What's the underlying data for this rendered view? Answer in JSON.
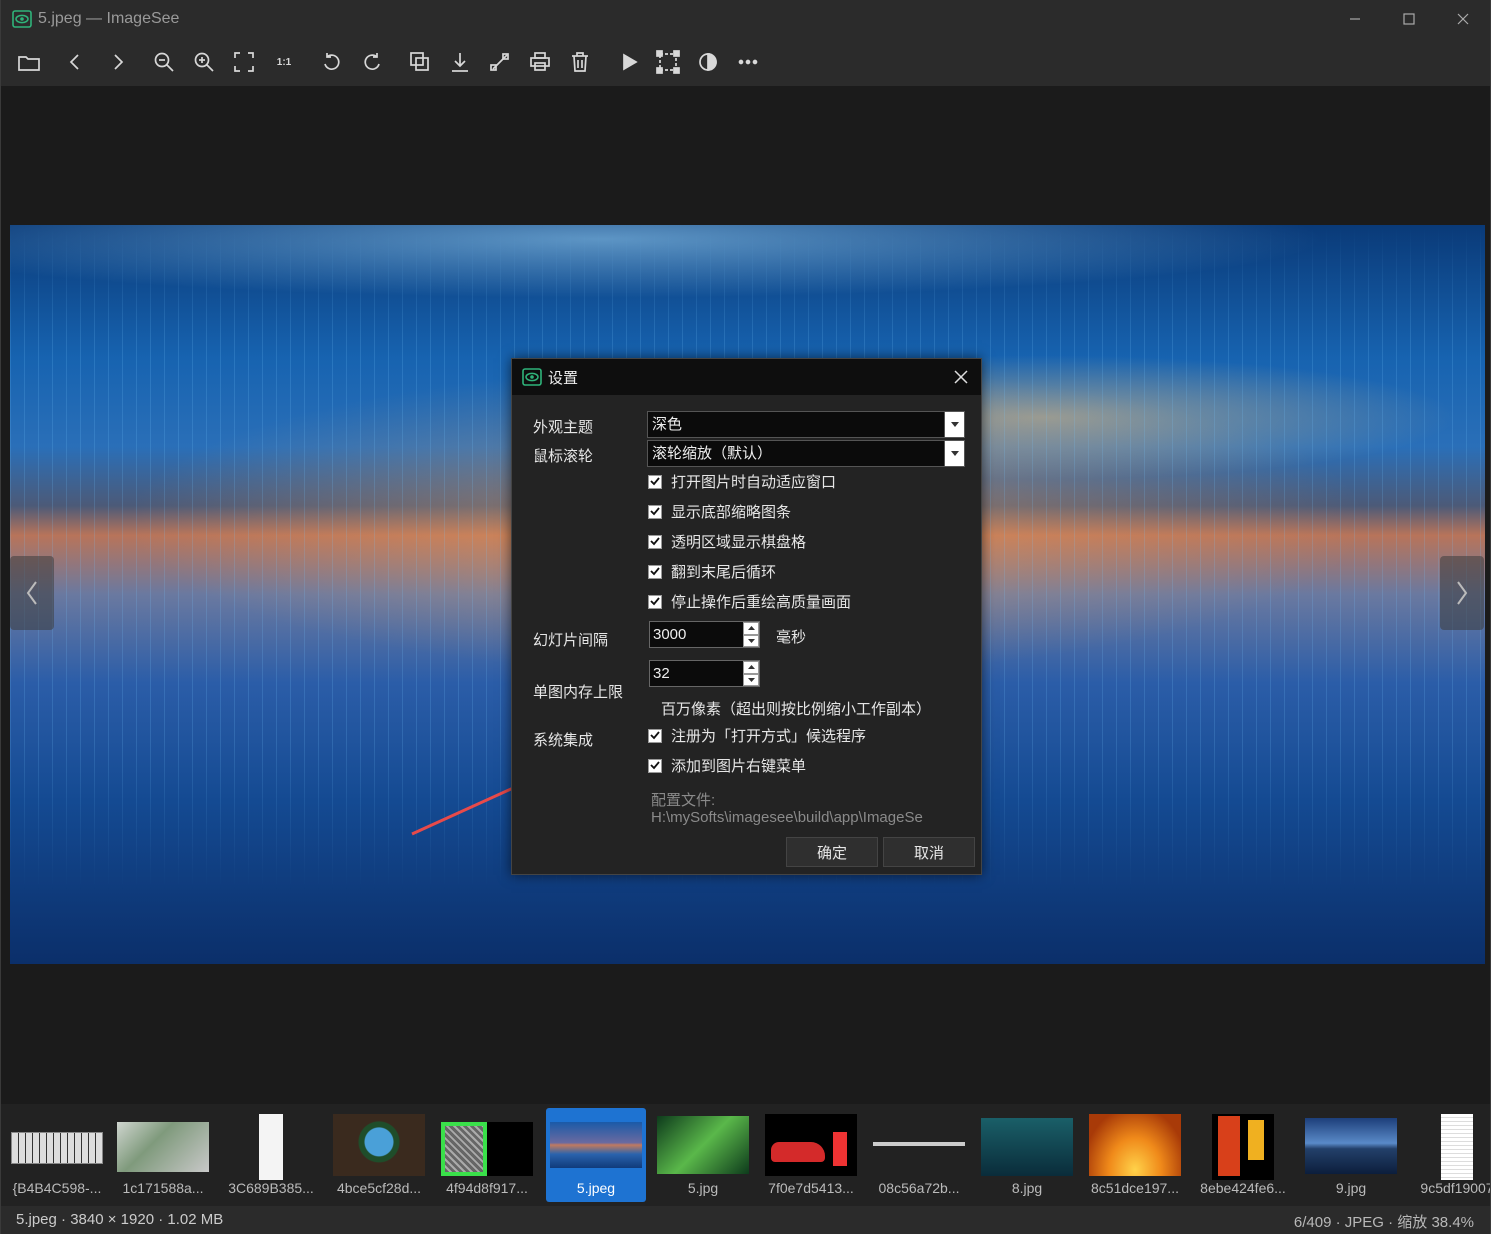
{
  "window": {
    "title": "5.jpeg",
    "separator": "—",
    "app_name": "ImageSee"
  },
  "toolbar": {
    "buttons": [
      "open-folder",
      "previous",
      "next",
      "zoom-out",
      "zoom-in",
      "fit-window",
      "actual-size",
      "rotate-left",
      "rotate-right",
      "copy",
      "save",
      "resize",
      "print",
      "delete",
      "slideshow",
      "crop",
      "adjust",
      "more"
    ],
    "actual_size_label": "1:1"
  },
  "dialog": {
    "title": "设置",
    "theme_label": "外观主题",
    "theme_value": "深色",
    "wheel_label": "鼠标滚轮",
    "wheel_value": "滚轮缩放（默认）",
    "checks": [
      "打开图片时自动适应窗口",
      "显示底部缩略图条",
      "透明区域显示棋盘格",
      "翻到末尾后循环",
      "停止操作后重绘高质量画面"
    ],
    "slideshow_label": "幻灯片间隔",
    "slideshow_value": "3000",
    "slideshow_unit": "毫秒",
    "memory_label": "单图内存上限",
    "memory_value": "32",
    "memory_note": "百万像素（超出则按比例缩小工作副本）",
    "integration_label": "系统集成",
    "integration_checks": [
      "注册为「打开方式」候选程序",
      "添加到图片右键菜单"
    ],
    "config_label": "配置文件:",
    "config_path": "H:\\mySofts\\imagesee\\build\\app\\ImageSe",
    "ok_label": "确定",
    "cancel_label": "取消"
  },
  "thumbnails": [
    {
      "name": "{B4B4C598-...",
      "kind": "keyboard"
    },
    {
      "name": "1c171588a...",
      "kind": "board"
    },
    {
      "name": "3C689B385...",
      "kind": "white"
    },
    {
      "name": "4bce5cf28d...",
      "kind": "earth"
    },
    {
      "name": "4f94d8f917...",
      "kind": "qr"
    },
    {
      "name": "5.jpeg",
      "kind": "city",
      "active": true
    },
    {
      "name": "5.jpg",
      "kind": "green"
    },
    {
      "name": "7f0e7d5413...",
      "kind": "car"
    },
    {
      "name": "08c56a72b...",
      "kind": "line"
    },
    {
      "name": "8.jpg",
      "kind": "underwater"
    },
    {
      "name": "8c51dce197...",
      "kind": "sunset"
    },
    {
      "name": "8ebe424fe6...",
      "kind": "pump"
    },
    {
      "name": "9.jpg",
      "kind": "lake"
    },
    {
      "name": "9c5df19007",
      "kind": "doc"
    }
  ],
  "status": {
    "filename": "5.jpeg",
    "dimensions": "3840 × 1920",
    "size": "1.02 MB",
    "position": "6/409",
    "format": "JPEG",
    "zoom": "缩放 38.4%",
    "sep": "·"
  },
  "colors": {
    "accent": "#1e73d2",
    "annotation_arrow": "#e84a4a",
    "title_bg": "#2b2b2b"
  }
}
